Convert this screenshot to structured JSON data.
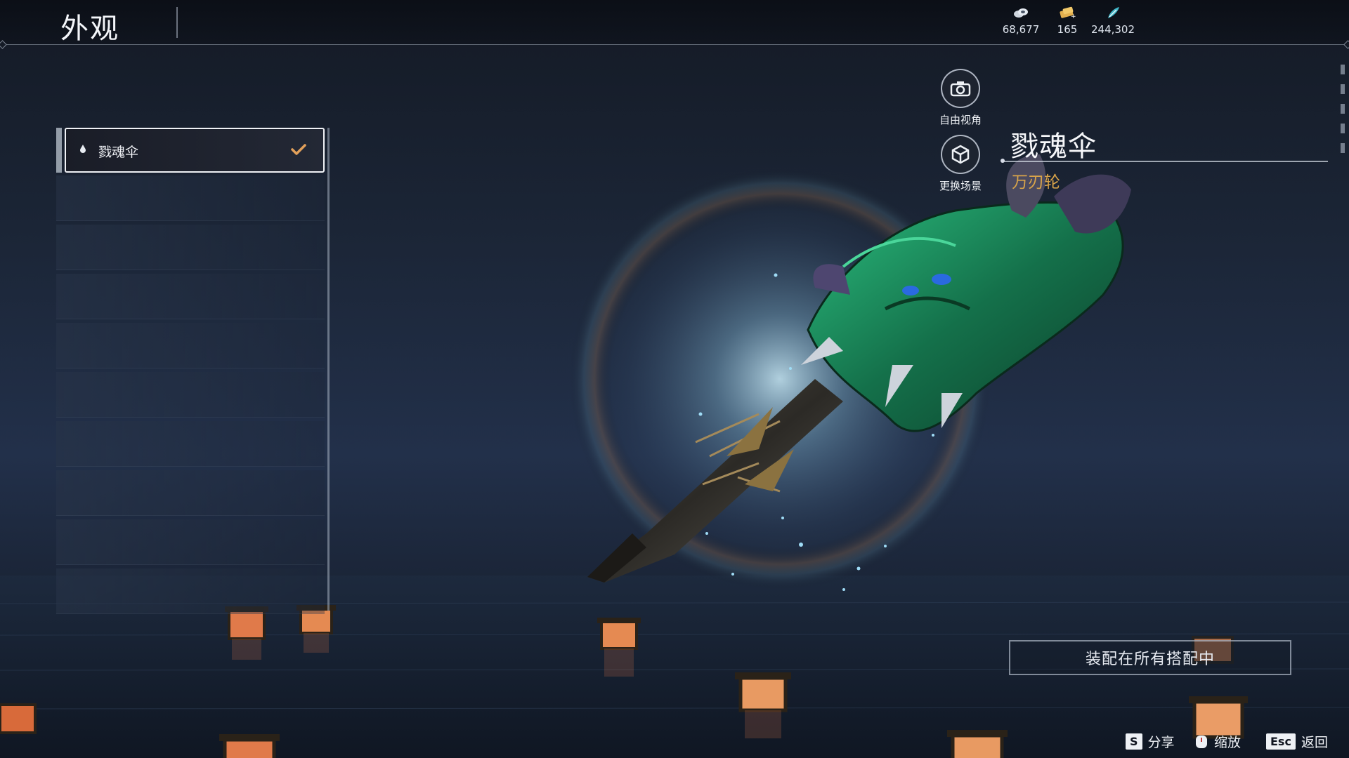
{
  "header": {
    "title": "外观",
    "currencies": [
      {
        "icon": "coin-stack-icon",
        "value": "68,677"
      },
      {
        "icon": "ticket-plus-icon",
        "value": "165"
      },
      {
        "icon": "feather-token-icon",
        "value": "244,302"
      }
    ]
  },
  "list": {
    "selected_item": {
      "icon": "drop-icon",
      "label": "戮魂伞",
      "checked": true
    }
  },
  "camera": {
    "free_view_label": "自由视角",
    "change_scene_label": "更换场景"
  },
  "item": {
    "name": "戮魂伞",
    "type": "万刃轮"
  },
  "actions": {
    "equip_all_label": "装配在所有搭配中"
  },
  "hints": [
    {
      "key": "S",
      "label": "分享"
    },
    {
      "key": "",
      "icon": "mouse-wheel-icon",
      "label": "缩放"
    },
    {
      "key": "Esc",
      "label": "返回"
    }
  ],
  "colors": {
    "accent_gold": "#d9a44a",
    "check_orange": "#e2a05a",
    "weapon_green": "#1f7a4e"
  }
}
